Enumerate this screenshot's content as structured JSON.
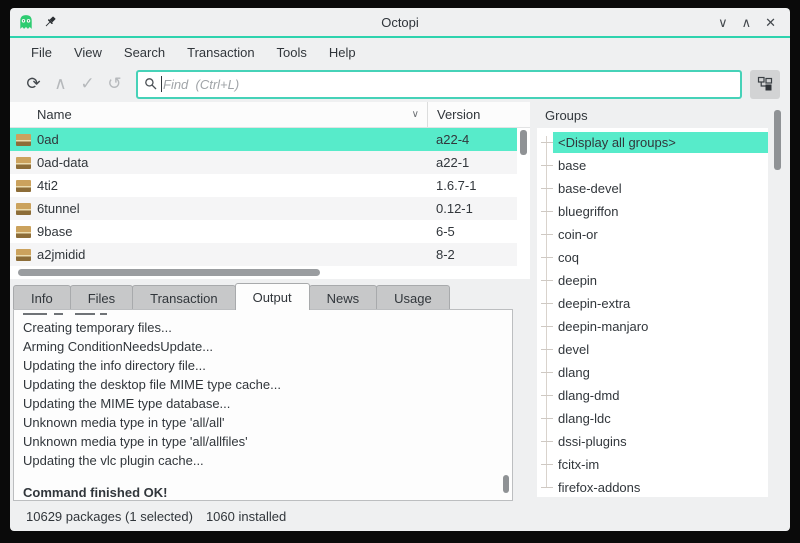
{
  "titlebar": {
    "title": "Octopi"
  },
  "window_controls": {
    "minimize": "∨",
    "maximize": "∧",
    "close": "✕"
  },
  "menubar": {
    "items": [
      "File",
      "View",
      "Search",
      "Transaction",
      "Tools",
      "Help"
    ]
  },
  "toolbar": {
    "sync_glyph": "⟳",
    "up_glyph": "∧",
    "apply_glyph": "✓",
    "undo_glyph": "↺",
    "search_placeholder": "Find  (Ctrl+L)"
  },
  "package_table": {
    "columns": [
      "Name",
      "Version"
    ],
    "selected_row": "0ad",
    "rows": [
      {
        "name": "0ad",
        "version": "a22-4"
      },
      {
        "name": "0ad-data",
        "version": "a22-1"
      },
      {
        "name": "4ti2",
        "version": "1.6.7-1"
      },
      {
        "name": "6tunnel",
        "version": "0.12-1"
      },
      {
        "name": "9base",
        "version": "6-5"
      },
      {
        "name": "a2jmidid",
        "version": "8-2"
      }
    ]
  },
  "tabs": {
    "items": [
      "Info",
      "Files",
      "Transaction",
      "Output",
      "News",
      "Usage"
    ],
    "active": "Output"
  },
  "output": {
    "lines": [
      "Creating temporary files...",
      "Arming ConditionNeedsUpdate...",
      "Updating the info directory file...",
      "Updating the desktop file MIME type cache...",
      "Updating the MIME type database...",
      "Unknown media type in type 'all/all'",
      "Unknown media type in type 'all/allfiles'",
      "Updating the vlc plugin cache..."
    ],
    "final_line": "Command finished OK!"
  },
  "groups": {
    "header": "Groups",
    "selected": "<Display all groups>",
    "items": [
      "<Display all groups>",
      "base",
      "base-devel",
      "bluegriffon",
      "coin-or",
      "coq",
      "deepin",
      "deepin-extra",
      "deepin-manjaro",
      "devel",
      "dlang",
      "dlang-dmd",
      "dlang-ldc",
      "dssi-plugins",
      "fcitx-im",
      "firefox-addons"
    ]
  },
  "statusbar": {
    "packages_text": "10629 packages (1 selected)",
    "installed_text": "1060 installed"
  },
  "colors": {
    "selection": "#57ebca",
    "titlebar_accent": "#2ed3ae",
    "search_border": "#46d2b8",
    "chrome": "#eff0f1",
    "text": "#31363b",
    "app_icon_green": "#2ecc71"
  }
}
